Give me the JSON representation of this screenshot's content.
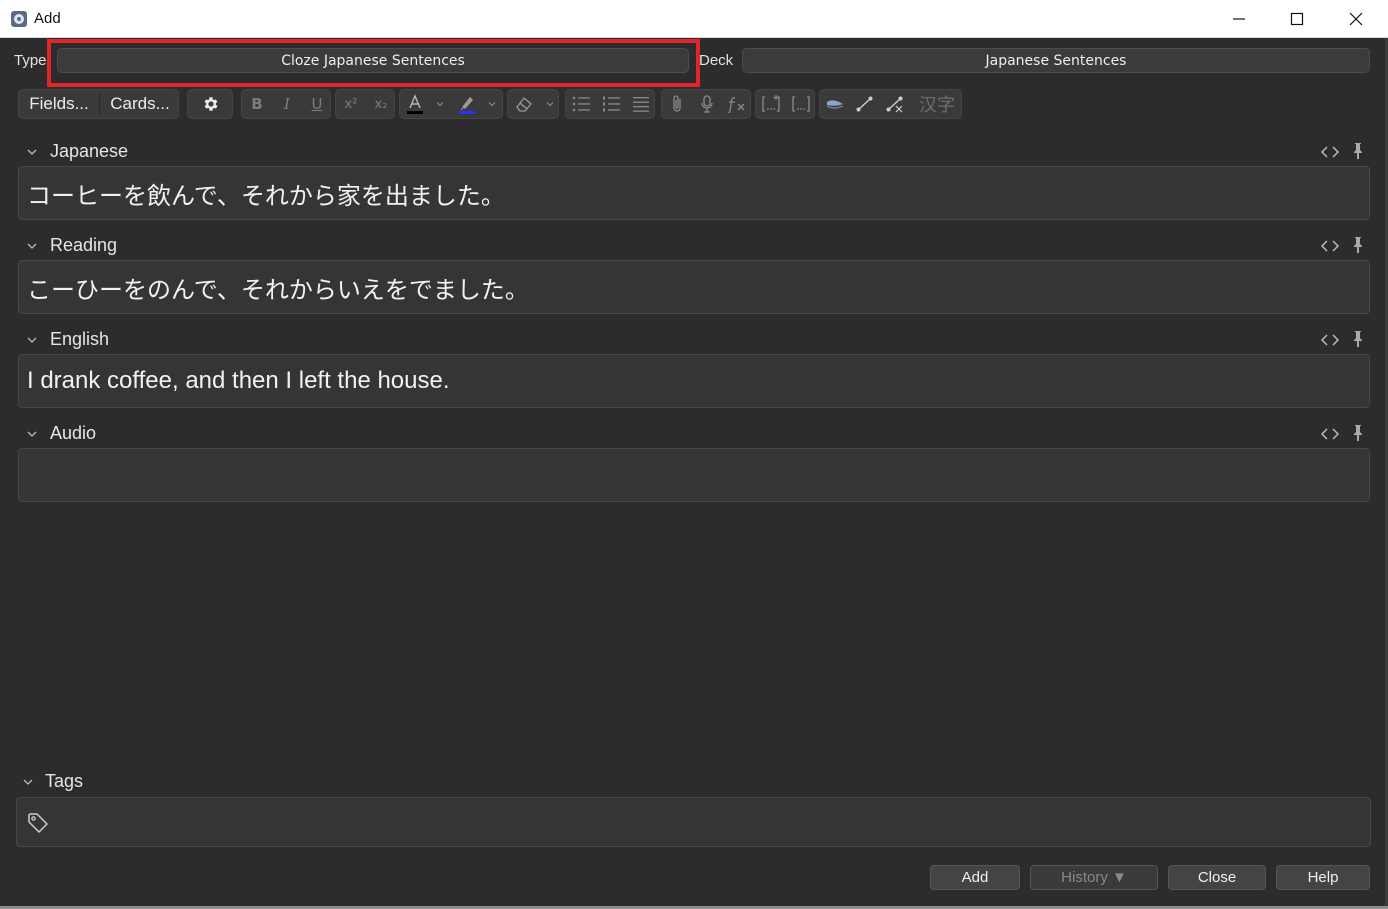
{
  "window": {
    "title": "Add",
    "minimize": "minimize",
    "maximize": "maximize",
    "close": "close"
  },
  "note_type": {
    "label": "Type",
    "value": "Cloze Japanese Sentences"
  },
  "deck": {
    "label": "Deck",
    "value": "Japanese Sentences"
  },
  "toolbar": {
    "fields_label": "Fields...",
    "cards_label": "Cards...",
    "bold": "B",
    "italic": "I",
    "underline": "U",
    "superscript": "x²",
    "subscript": "x₂",
    "text_color": "A",
    "font_color": "#000000",
    "highlight_color": "#2434ff",
    "kanji_label": "汉字"
  },
  "fields": [
    {
      "name": "Japanese",
      "value": "コーヒーを飲んで、それから家を出ました。"
    },
    {
      "name": "Reading",
      "value": "こーひーをのんで、それからいえをでました。"
    },
    {
      "name": "English",
      "value": "I drank coffee, and then I left the house."
    },
    {
      "name": "Audio",
      "value": ""
    }
  ],
  "tags": {
    "label": "Tags",
    "value": ""
  },
  "buttons": {
    "add": "Add",
    "history": "History ▼",
    "close": "Close",
    "help": "Help"
  },
  "colors": {
    "background": "#2c2c2c",
    "field_bg": "#353535",
    "highlight_box": "#e0262c"
  }
}
